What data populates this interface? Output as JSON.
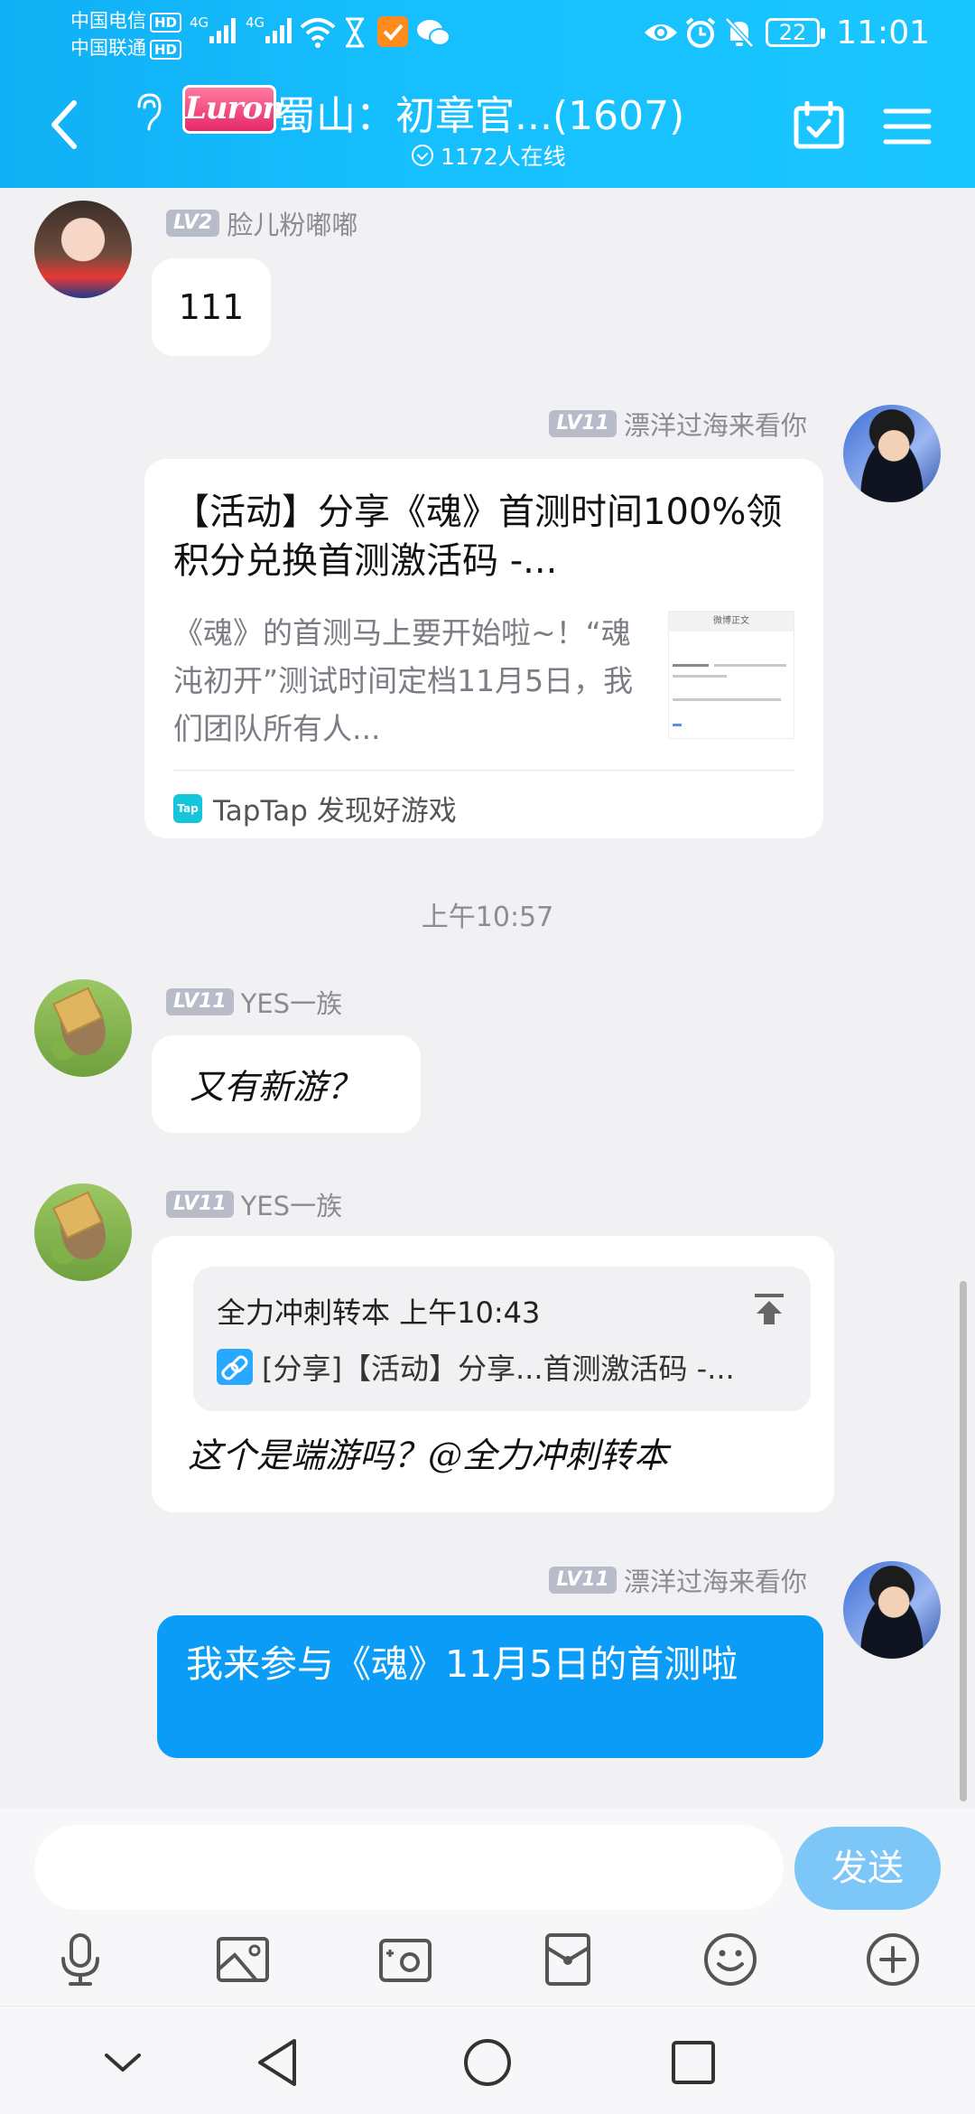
{
  "status": {
    "carrier1": "中国电信",
    "carrier2": "中国联通",
    "hd": "HD",
    "network": "4G",
    "battery": "22",
    "time": "11:01"
  },
  "header": {
    "badge": "Luron",
    "title": "蜀山：初章官...(1607)",
    "online": "1172人在线"
  },
  "messages": [
    {
      "level": "LV2",
      "name": "脸儿粉嘟嘟",
      "text": "111"
    },
    {
      "level": "LV11",
      "name": "漂洋过海来看你",
      "card": {
        "title": "【活动】分享《魂》首测时间100%领积分兑换首测激活码 -...",
        "desc": "《魂》的首测马上要开始啦~！“魂沌初开”测试时间定档11月5日，我们团队所有人...",
        "thumb_title": "微博正文",
        "source": "TapTap 发现好游戏",
        "source_icon": "Tap"
      }
    },
    {
      "level": "LV11",
      "name": "YES一族",
      "text": "又有新游？"
    },
    {
      "level": "LV11",
      "name": "YES一族",
      "quote_head": "全力冲刺转本 上午10:43",
      "quote_body": "[分享]【活动】分享...首测激活码 -...",
      "text": "这个是端游吗？@全力冲刺转本"
    },
    {
      "level": "LV11",
      "name": "漂洋过海来看你",
      "text": "我来参与《魂》11月5日的首测啦"
    }
  ],
  "time_label": "上午10:57",
  "input": {
    "placeholder": "",
    "send_label": "发送"
  },
  "colors": {
    "header": "#16c0ff",
    "own_bubble": "#0a9cf6",
    "send_button": "#7cc6f8"
  },
  "toolbar_icons": [
    "microphone-icon",
    "image-icon",
    "camera-icon",
    "red-packet-icon",
    "emoji-icon",
    "plus-icon"
  ]
}
